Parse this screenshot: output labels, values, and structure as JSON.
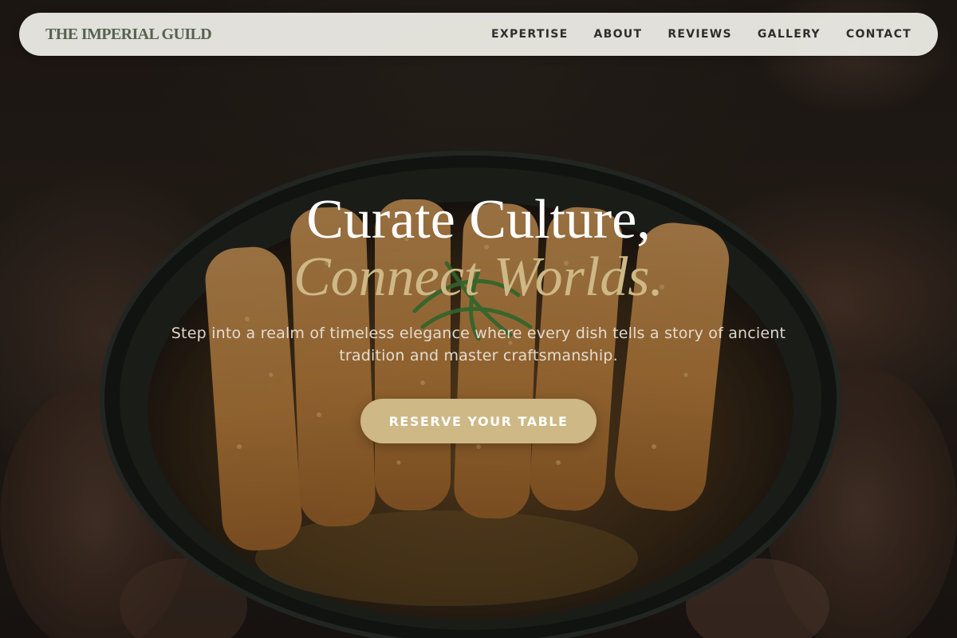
{
  "brand": {
    "name": "THE IMPERIAL GUILD"
  },
  "nav": {
    "items": [
      {
        "label": "EXPERTISE"
      },
      {
        "label": "ABOUT"
      },
      {
        "label": "REVIEWS"
      },
      {
        "label": "GALLERY"
      },
      {
        "label": "CONTACT"
      }
    ]
  },
  "hero": {
    "headline_line1": "Curate Culture,",
    "headline_line2": "Connect Worlds.",
    "subtitle": "Step into a realm of timeless elegance where every dish tells a story of ancient tradition and master craftsmanship.",
    "cta_label": "RESERVE YOUR TABLE",
    "background_image": "katsu-bowl-photo"
  },
  "colors": {
    "accent_gold": "#cdb886",
    "brand_green": "#55634f",
    "nav_background": "#f0f0ea",
    "nav_text": "#2e2e2e"
  }
}
